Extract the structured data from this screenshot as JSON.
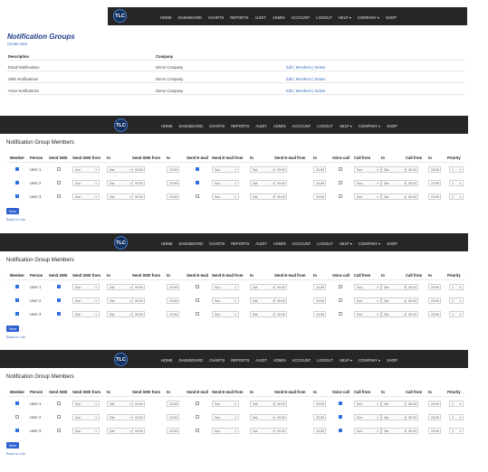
{
  "nav": {
    "logo_text": "TLC",
    "items": [
      "HOME",
      "DASHBOARD",
      "CHARTS",
      "REPORTS",
      "AUDIT",
      "ADMIN",
      "ACCOUNT",
      "LOGOUT",
      "HELP ▾",
      "COMPANY ▾",
      "SHOP"
    ]
  },
  "groups": {
    "title": "Notification Groups",
    "create_link": "Create New",
    "col_description": "Description",
    "col_company": "Company",
    "rows": [
      {
        "description": "Email Notifications",
        "company": "Demo Company",
        "actions": "Edit | Members | Delete"
      },
      {
        "description": "SMS Notifications",
        "company": "Demo Company",
        "actions": "Edit | Members | Delete"
      },
      {
        "description": "Voice Notifications",
        "company": "Demo Company",
        "actions": "Edit | Members | Delete"
      }
    ]
  },
  "members": {
    "title": "Notification Group Members",
    "headers": [
      "Member",
      "Person",
      "Send SMS",
      "Send SMS from",
      "to",
      "Send SMS from",
      "to",
      "Send E-mail",
      "Send E-mail from",
      "to",
      "Send E-mail from",
      "to",
      "Voice call",
      "Call from",
      "to",
      "Call from",
      "to",
      "Priority"
    ],
    "save_label": "Save",
    "back_label": "Back to List",
    "day_from": "Sun",
    "day_to": "Sat",
    "priority_value": "1"
  },
  "sections": [
    {
      "rows": [
        {
          "user": "User 1",
          "member": true,
          "sms": false,
          "email": true,
          "voice": false,
          "sms_t1": "00:00",
          "sms_t2": "23:59",
          "em_t1": "00:00",
          "em_t2": "23:59",
          "call_t1": "00:00",
          "call_t2": "23:59",
          "pri": "1"
        },
        {
          "user": "User 2",
          "member": true,
          "sms": false,
          "email": true,
          "voice": false,
          "sms_t1": "00:00",
          "sms_t2": "23:59",
          "em_t1": "00:00",
          "em_t2": "23:59",
          "call_t1": "00:00",
          "call_t2": "23:59",
          "pri": "1"
        },
        {
          "user": "User 3",
          "member": true,
          "sms": false,
          "email": false,
          "voice": false,
          "sms_t1": "00:00",
          "sms_t2": "23:59",
          "em_t1": "00:00",
          "em_t2": "23:59",
          "call_t1": "00:00",
          "call_t2": "23:59",
          "pri": "1"
        }
      ]
    },
    {
      "rows": [
        {
          "user": "User 1",
          "member": true,
          "sms": true,
          "email": false,
          "voice": false,
          "sms_t1": "00:00",
          "sms_t2": "23:59",
          "em_t1": "00:00",
          "em_t2": "23:59",
          "call_t1": "00:00",
          "call_t2": "23:59",
          "pri": "1"
        },
        {
          "user": "User 2",
          "member": true,
          "sms": true,
          "email": false,
          "voice": false,
          "sms_t1": "00:00",
          "sms_t2": "23:59",
          "em_t1": "00:00",
          "em_t2": "23:59",
          "call_t1": "00:00",
          "call_t2": "23:59",
          "pri": "1"
        },
        {
          "user": "User 3",
          "member": true,
          "sms": true,
          "email": false,
          "voice": false,
          "sms_t1": "00:00",
          "sms_t2": "23:59",
          "em_t1": "00:00",
          "em_t2": "23:59",
          "call_t1": "00:00",
          "call_t2": "23:59",
          "pri": "1"
        }
      ]
    },
    {
      "rows": [
        {
          "user": "User 1",
          "member": true,
          "sms": false,
          "email": false,
          "voice": true,
          "sms_t1": "00:00",
          "sms_t2": "23:59",
          "em_t1": "00:00",
          "em_t2": "23:59",
          "call_t1": "00:00",
          "call_t2": "23:59",
          "pri": "1"
        },
        {
          "user": "User 2",
          "member": false,
          "sms": false,
          "email": false,
          "voice": true,
          "sms_t1": "00:00",
          "sms_t2": "23:59",
          "em_t1": "00:00",
          "em_t2": "23:59",
          "call_t1": "00:00",
          "call_t2": "23:59",
          "pri": "2"
        },
        {
          "user": "User 3",
          "member": true,
          "sms": false,
          "email": false,
          "voice": true,
          "sms_t1": "00:00",
          "sms_t2": "23:59",
          "em_t1": "00:00",
          "em_t2": "23:59",
          "call_t1": "00:00",
          "call_t2": "23:59",
          "pri": "3"
        }
      ]
    }
  ],
  "colors": {
    "nav_bg": "#262626",
    "accent": "#2f5fd0",
    "title": "#1f3b8a",
    "link": "#3a6fbf"
  }
}
